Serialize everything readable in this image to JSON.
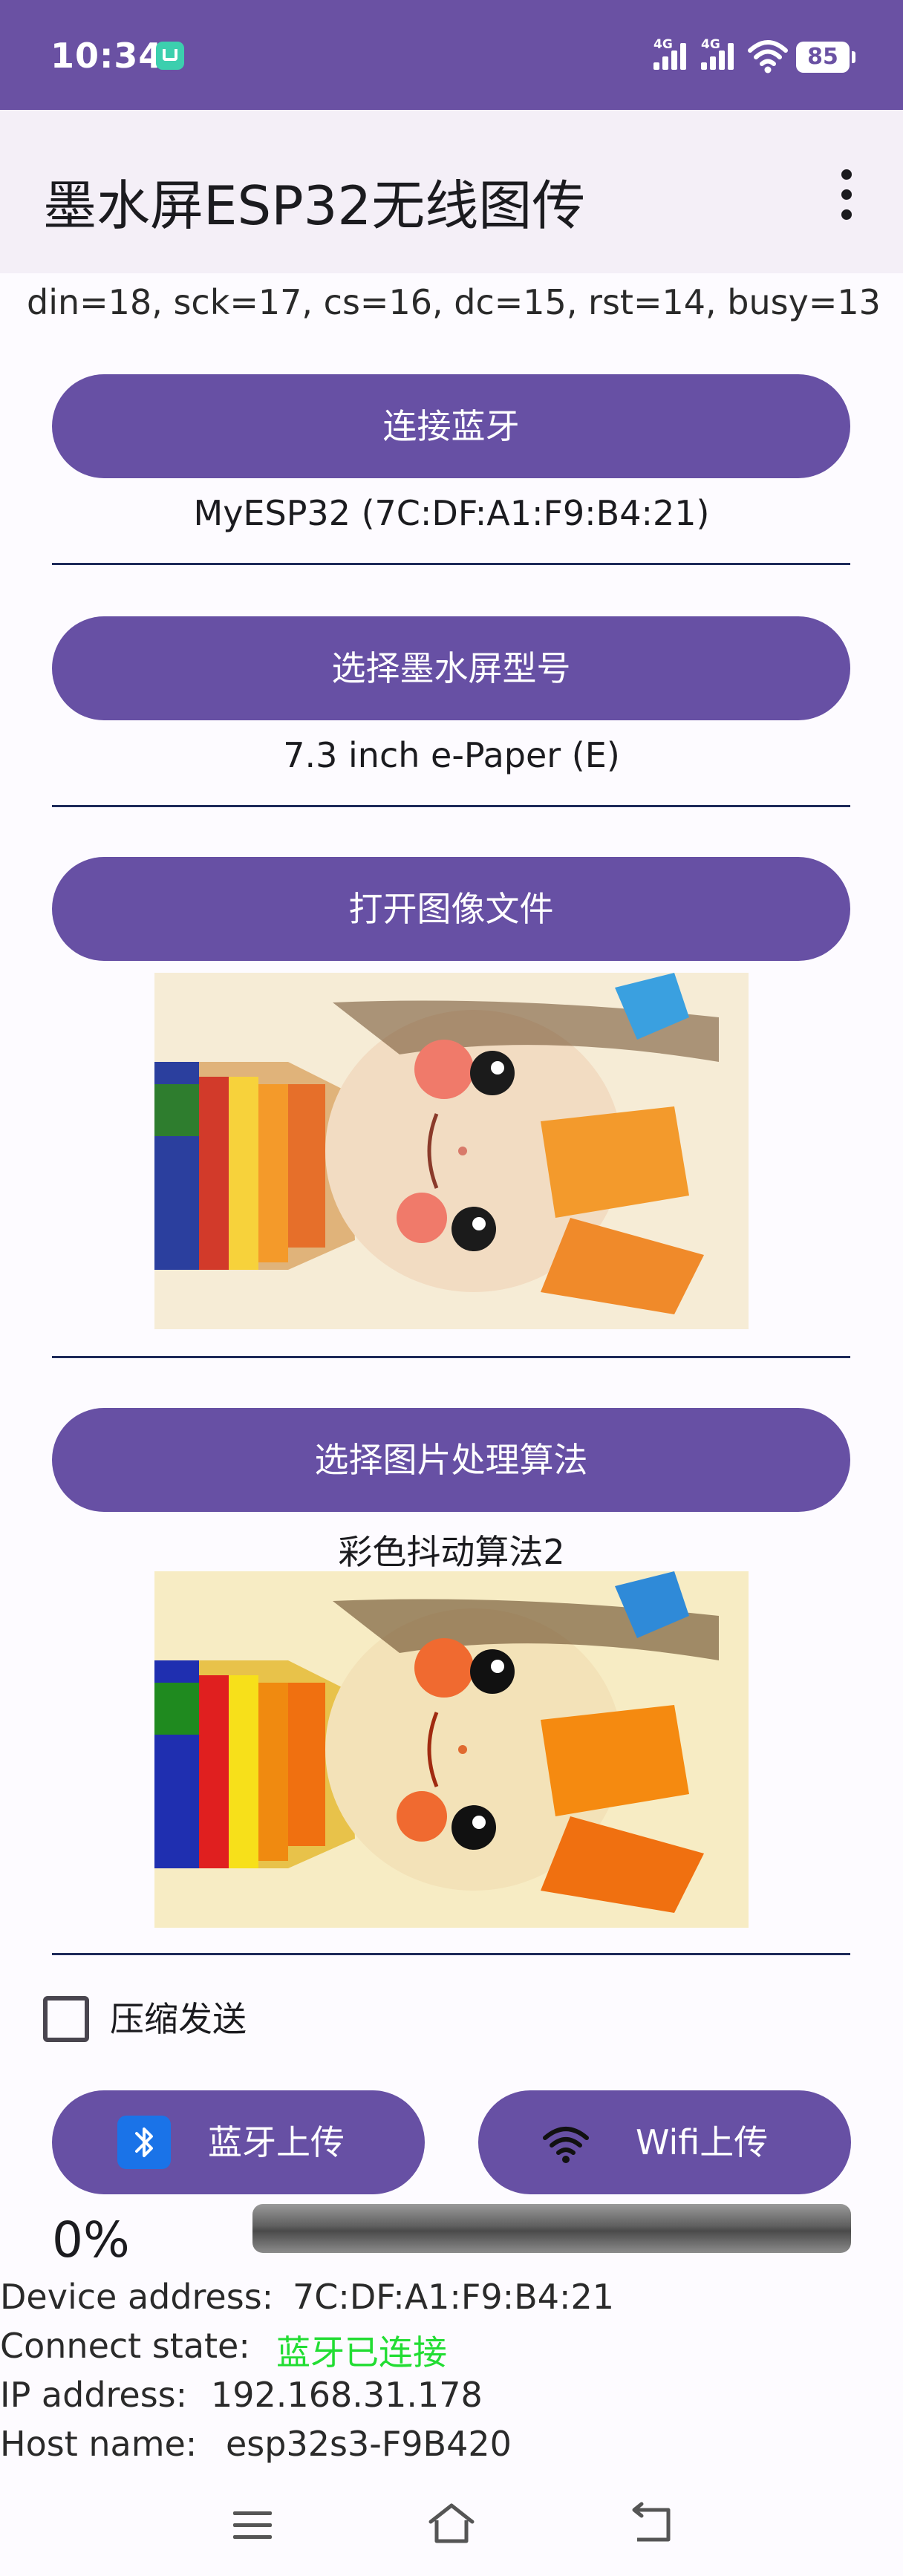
{
  "status_bar": {
    "time": "10:34",
    "signal_1_label": "4G",
    "signal_2_label": "4G",
    "battery": "85",
    "icons": [
      "mi-app-icon",
      "signal-icon",
      "signal-icon",
      "wifi-icon",
      "battery-icon"
    ]
  },
  "app_bar": {
    "title": "墨水屏ESP32无线图传",
    "menu_icon": "overflow-menu-icon"
  },
  "pin_config": "din=18, sck=17, cs=16, dc=15, rst=14, busy=13",
  "bluetooth": {
    "connect_button": "连接蓝牙",
    "device": "MyESP32 (7C:DF:A1:F9:B4:21)"
  },
  "display": {
    "select_button": "选择墨水屏型号",
    "model": "7.3 inch e-Paper (E)"
  },
  "image": {
    "open_button": "打开图像文件"
  },
  "algorithm": {
    "select_button": "选择图片处理算法",
    "selected": "彩色抖动算法2"
  },
  "compress": {
    "label": "压缩发送",
    "checked": false
  },
  "upload": {
    "bluetooth_button": "蓝牙上传",
    "wifi_button": "Wifi上传",
    "bluetooth_icon": "bluetooth-icon",
    "wifi_icon": "wifi-icon"
  },
  "progress": {
    "percent_text": "0%",
    "value": 0
  },
  "info": {
    "device_address_label": "Device address:",
    "device_address": "7C:DF:A1:F9:B4:21",
    "connect_state_label": "Connect state:",
    "connect_state": "蓝牙已连接",
    "connect_state_color": "#22dd33",
    "ip_address_label": "IP address:",
    "ip_address": "192.168.31.178",
    "host_name_label": "Host name:",
    "host_name": "esp32s3-F9B420"
  },
  "nav_bar": {
    "icons": [
      "menu-icon",
      "home-icon",
      "back-icon"
    ]
  },
  "colors": {
    "primary": "#6750a4",
    "status_bar": "#6a51a3",
    "app_bar": "#f4eff7",
    "divider": "#1e2a5a"
  }
}
